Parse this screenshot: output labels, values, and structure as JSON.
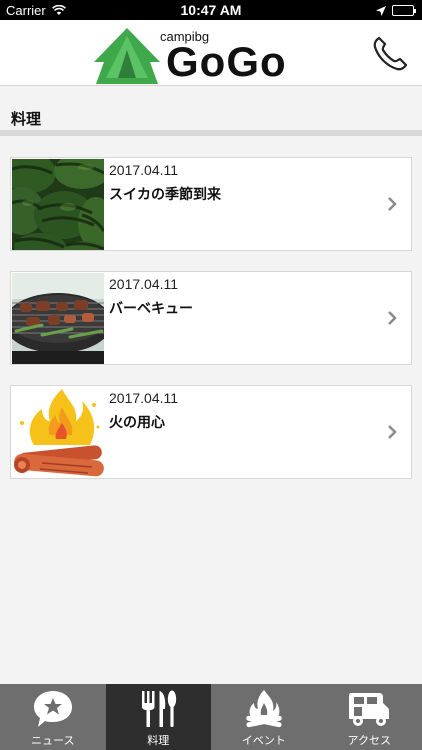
{
  "status_bar": {
    "carrier": "Carrier",
    "time": "10:47 AM"
  },
  "header": {
    "logo_small": "campibg",
    "logo_big": "GoGo"
  },
  "section": {
    "title": "料理"
  },
  "articles": [
    {
      "date": "2017.04.11",
      "title": "スイカの季節到来",
      "image": "watermelons-photo"
    },
    {
      "date": "2017.04.11",
      "title": "バーベキュー",
      "image": "barbecue-grill-photo"
    },
    {
      "date": "2017.04.11",
      "title": "火の用心",
      "image": "campfire-illustration"
    }
  ],
  "tabs": [
    {
      "label": "ニュース",
      "icon": "speech-bubble-star-icon",
      "active": false
    },
    {
      "label": "料理",
      "icon": "fork-knife-icon",
      "active": true
    },
    {
      "label": "イベント",
      "icon": "campfire-icon",
      "active": false
    },
    {
      "label": "アクセス",
      "icon": "camper-van-icon",
      "active": false
    }
  ],
  "colors": {
    "logo_green": "#3fa84a",
    "tab_bar": "#6e6e6e",
    "tab_active": "#2e2e2e"
  }
}
